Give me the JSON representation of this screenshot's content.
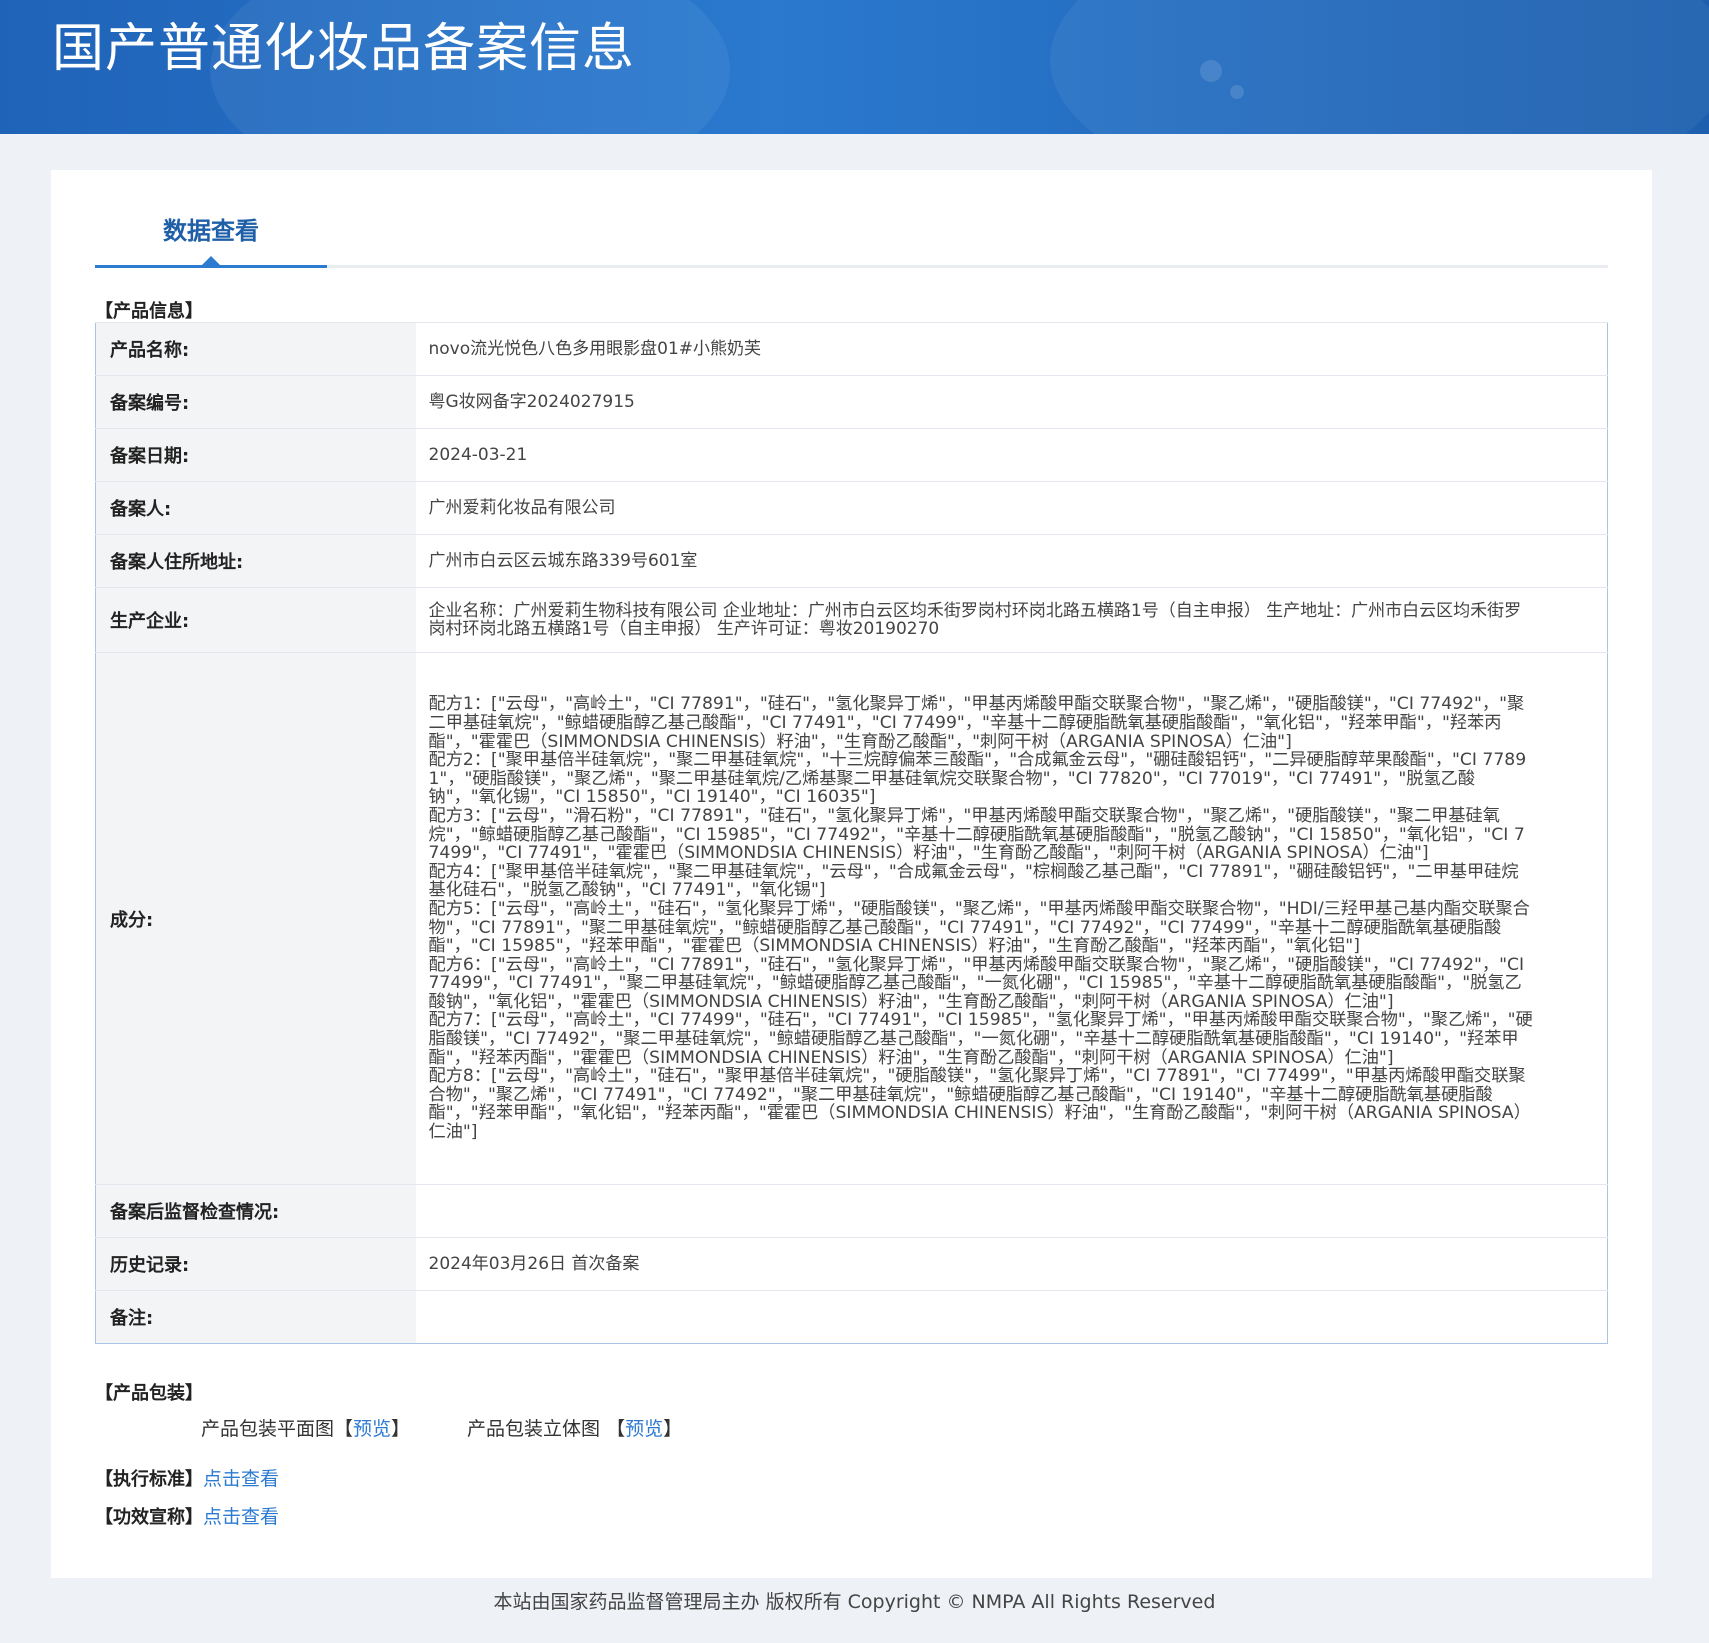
{
  "header": {
    "title": "国产普通化妆品备案信息"
  },
  "tab": {
    "label": "数据查看"
  },
  "sections": {
    "product_info": "【产品信息】",
    "packaging": "【产品包装】",
    "standard": "【执行标准】",
    "efficacy": "【功效宣称】"
  },
  "rows": [
    {
      "key": "产品名称:",
      "value": "novo流光悦色八色多用眼影盘01#小熊奶芙"
    },
    {
      "key": "备案编号:",
      "value": "粤G妆网备字2024027915"
    },
    {
      "key": "备案日期:",
      "value": "2024-03-21"
    },
    {
      "key": "备案人:",
      "value": "广州爱莉化妆品有限公司"
    },
    {
      "key": "备案人住所地址:",
      "value": "广州市白云区云城东路339号601室"
    },
    {
      "key": "生产企业:",
      "value": "企业名称：广州爱莉生物科技有限公司 企业地址：广州市白云区均禾街罗岗村环岗北路五横路1号（自主申报） 生产地址：广州市白云区均禾街罗岗村环岗北路五横路1号（自主申报） 生产许可证：粤妆20190270"
    },
    {
      "key": "成分:",
      "formulas": [
        "配方1：[\"云母\"，\"高岭土\"，\"CI 77891\"，\"硅石\"，\"氢化聚异丁烯\"，\"甲基丙烯酸甲酯交联聚合物\"，\"聚乙烯\"，\"硬脂酸镁\"，\"CI 77492\"，\"聚二甲基硅氧烷\"，\"鲸蜡硬脂醇乙基己酸酯\"，\"CI 77491\"，\"CI 77499\"，\"辛基十二醇硬脂酰氧基硬脂酸酯\"，\"氧化铝\"，\"羟苯甲酯\"，\"羟苯丙酯\"，\"霍霍巴（SIMMONDSIA CHINENSIS）籽油\"，\"生育酚乙酸酯\"，\"刺阿干树（ARGANIA SPINOSA）仁油\"]",
        "配方2：[\"聚甲基倍半硅氧烷\"，\"聚二甲基硅氧烷\"，\"十三烷醇偏苯三酸酯\"，\"合成氟金云母\"，\"硼硅酸铝钙\"，\"二异硬脂醇苹果酸酯\"，\"CI 77891\"，\"硬脂酸镁\"，\"聚乙烯\"，\"聚二甲基硅氧烷/乙烯基聚二甲基硅氧烷交联聚合物\"，\"CI 77820\"，\"CI 77019\"，\"CI 77491\"，\"脱氢乙酸钠\"，\"氧化锡\"，\"CI 15850\"，\"CI 19140\"，\"CI 16035\"]",
        "配方3：[\"云母\"，\"滑石粉\"，\"CI 77891\"，\"硅石\"，\"氢化聚异丁烯\"，\"甲基丙烯酸甲酯交联聚合物\"，\"聚乙烯\"，\"硬脂酸镁\"，\"聚二甲基硅氧烷\"，\"鲸蜡硬脂醇乙基己酸酯\"，\"CI 15985\"，\"CI 77492\"，\"辛基十二醇硬脂酰氧基硬脂酸酯\"，\"脱氢乙酸钠\"，\"CI 15850\"，\"氧化铝\"，\"CI 77499\"，\"CI 77491\"，\"霍霍巴（SIMMONDSIA CHINENSIS）籽油\"，\"生育酚乙酸酯\"，\"刺阿干树（ARGANIA SPINOSA）仁油\"]",
        "配方4：[\"聚甲基倍半硅氧烷\"，\"聚二甲基硅氧烷\"，\"云母\"，\"合成氟金云母\"，\"棕榈酸乙基己酯\"，\"CI 77891\"，\"硼硅酸铝钙\"，\"二甲基甲硅烷基化硅石\"，\"脱氢乙酸钠\"，\"CI 77491\"，\"氧化锡\"]",
        "配方5：[\"云母\"，\"高岭土\"，\"硅石\"，\"氢化聚异丁烯\"，\"硬脂酸镁\"，\"聚乙烯\"，\"甲基丙烯酸甲酯交联聚合物\"，\"HDI/三羟甲基己基内酯交联聚合物\"，\"CI 77891\"，\"聚二甲基硅氧烷\"，\"鲸蜡硬脂醇乙基己酸酯\"，\"CI 77491\"，\"CI 77492\"，\"CI 77499\"，\"辛基十二醇硬脂酰氧基硬脂酸酯\"，\"CI 15985\"，\"羟苯甲酯\"，\"霍霍巴（SIMMONDSIA CHINENSIS）籽油\"，\"生育酚乙酸酯\"，\"羟苯丙酯\"，\"氧化铝\"]",
        "配方6：[\"云母\"，\"高岭土\"，\"CI 77891\"，\"硅石\"，\"氢化聚异丁烯\"，\"甲基丙烯酸甲酯交联聚合物\"，\"聚乙烯\"，\"硬脂酸镁\"，\"CI 77492\"，\"CI 77499\"，\"CI 77491\"，\"聚二甲基硅氧烷\"，\"鲸蜡硬脂醇乙基己酸酯\"，\"一氮化硼\"，\"CI 15985\"，\"辛基十二醇硬脂酰氧基硬脂酸酯\"，\"脱氢乙酸钠\"，\"氧化铝\"，\"霍霍巴（SIMMONDSIA CHINENSIS）籽油\"，\"生育酚乙酸酯\"，\"刺阿干树（ARGANIA SPINOSA）仁油\"]",
        "配方7：[\"云母\"，\"高岭土\"，\"CI 77499\"，\"硅石\"，\"CI 77491\"，\"CI 15985\"，\"氢化聚异丁烯\"，\"甲基丙烯酸甲酯交联聚合物\"，\"聚乙烯\"，\"硬脂酸镁\"，\"CI 77492\"，\"聚二甲基硅氧烷\"，\"鲸蜡硬脂醇乙基己酸酯\"，\"一氮化硼\"，\"辛基十二醇硬脂酰氧基硬脂酸酯\"，\"CI 19140\"，\"羟苯甲酯\"，\"羟苯丙酯\"，\"霍霍巴（SIMMONDSIA CHINENSIS）籽油\"，\"生育酚乙酸酯\"，\"刺阿干树（ARGANIA SPINOSA）仁油\"]",
        "配方8：[\"云母\"，\"高岭土\"，\"硅石\"，\"聚甲基倍半硅氧烷\"，\"硬脂酸镁\"，\"氢化聚异丁烯\"，\"CI 77891\"，\"CI 77499\"，\"甲基丙烯酸甲酯交联聚合物\"，\"聚乙烯\"，\"CI 77491\"，\"CI 77492\"，\"聚二甲基硅氧烷\"，\"鲸蜡硬脂醇乙基己酸酯\"，\"CI 19140\"，\"辛基十二醇硬脂酰氧基硬脂酸酯\"，\"羟苯甲酯\"，\"氧化铝\"，\"羟苯丙酯\"，\"霍霍巴（SIMMONDSIA CHINENSIS）籽油\"，\"生育酚乙酸酯\"，\"刺阿干树（ARGANIA SPINOSA）仁油\"]"
      ]
    },
    {
      "key": "备案后监督检查情况:",
      "value": ""
    },
    {
      "key": "历史记录:",
      "value": "2024年03月26日 首次备案"
    },
    {
      "key": "备注:",
      "value": ""
    }
  ],
  "packaging": {
    "flat_label": "产品包装平面图",
    "flat_link": "预览",
    "stereo_label": "产品包装立体图",
    "stereo_link": "预览",
    "bracket_open": "【",
    "bracket_close": "】"
  },
  "links": {
    "standard_link": "点击查看",
    "efficacy_link": "点击查看"
  },
  "footer": {
    "text": "本站由国家药品监督管理局主办 版权所有 Copyright © NMPA All Rights Reserved"
  }
}
